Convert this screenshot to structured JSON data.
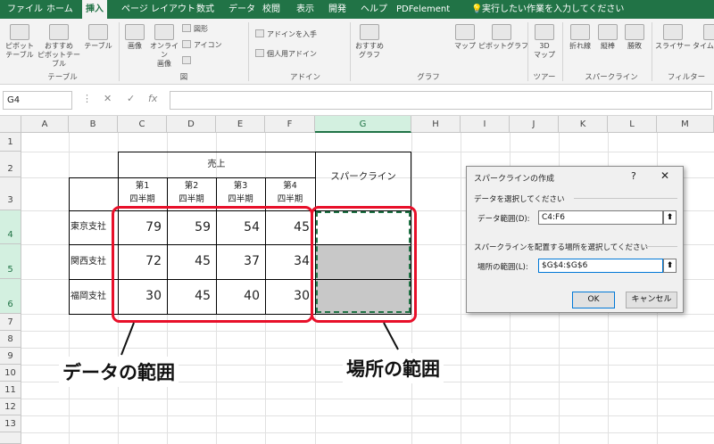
{
  "ribbon_tabs": [
    "ファイル",
    "ホーム",
    "挿入",
    "ページ レイアウト",
    "数式",
    "データ",
    "校閲",
    "表示",
    "開発",
    "ヘルプ",
    "PDFelement"
  ],
  "active_tab": "挿入",
  "tell_me": "実行したい作業を入力してください",
  "ribbon": {
    "pivot_table": "ピボット\nテーブル",
    "recommended_pivot": "おすすめ\nピボットテーブル",
    "table": "テーブル",
    "image": "画像",
    "online_image": "オンライン\n画像",
    "shapes": "図形",
    "icons": "アイコン",
    "get_addins": "アドインを入手",
    "personal_addins": "個人用アドイン",
    "recommended_charts": "おすすめ\nグラフ",
    "maps": "マップ",
    "pivot_chart": "ピボットグラフ",
    "threed_map": "3D\nマップ",
    "line": "折れ線",
    "column": "縦棒",
    "winloss": "勝敗",
    "slicer": "スライサー",
    "timeline": "タイムライン",
    "groups": {
      "tables": "テーブル",
      "illustrations": "図",
      "addins": "アドイン",
      "charts": "グラフ",
      "tours": "ツアー",
      "sparklines": "スパークライン",
      "filters": "フィルター"
    }
  },
  "formula_bar": {
    "name_box": "G4",
    "cancel": "✕",
    "enter": "✓",
    "fx": "fx",
    "content": ""
  },
  "columns": [
    "A",
    "B",
    "C",
    "D",
    "E",
    "F",
    "G",
    "H",
    "I",
    "J",
    "K",
    "L",
    "M"
  ],
  "selected_column": "G",
  "rows": [
    "1",
    "2",
    "3",
    "4",
    "5",
    "6",
    "7",
    "8",
    "9",
    "10",
    "11",
    "12",
    "13"
  ],
  "table": {
    "sales_header": "売上",
    "sparkline_header": "スパークライン",
    "quarters": [
      "第1\n四半期",
      "第2\n四半期",
      "第3\n四半期",
      "第4\n四半期"
    ],
    "branches": [
      {
        "name": "東京支社",
        "values": [
          "79",
          "59",
          "54",
          "45"
        ]
      },
      {
        "name": "関西支社",
        "values": [
          "72",
          "45",
          "37",
          "34"
        ]
      },
      {
        "name": "福岡支社",
        "values": [
          "30",
          "45",
          "40",
          "30"
        ]
      }
    ]
  },
  "annotations": {
    "data_range": "データの範囲",
    "location_range": "場所の範囲"
  },
  "dialog": {
    "title": "スパークラインの作成",
    "help": "?",
    "close": "✕",
    "section_data": "データを選択してください",
    "data_range_label": "データ範囲(D):",
    "data_range_value": "C4:F6",
    "section_location": "スパークラインを配置する場所を選択してください",
    "location_range_label": "場所の範囲(L):",
    "location_range_value": "$G$4:$G$6",
    "collapse_glyph": "⬆",
    "ok": "OK",
    "cancel": "キャンセル"
  }
}
